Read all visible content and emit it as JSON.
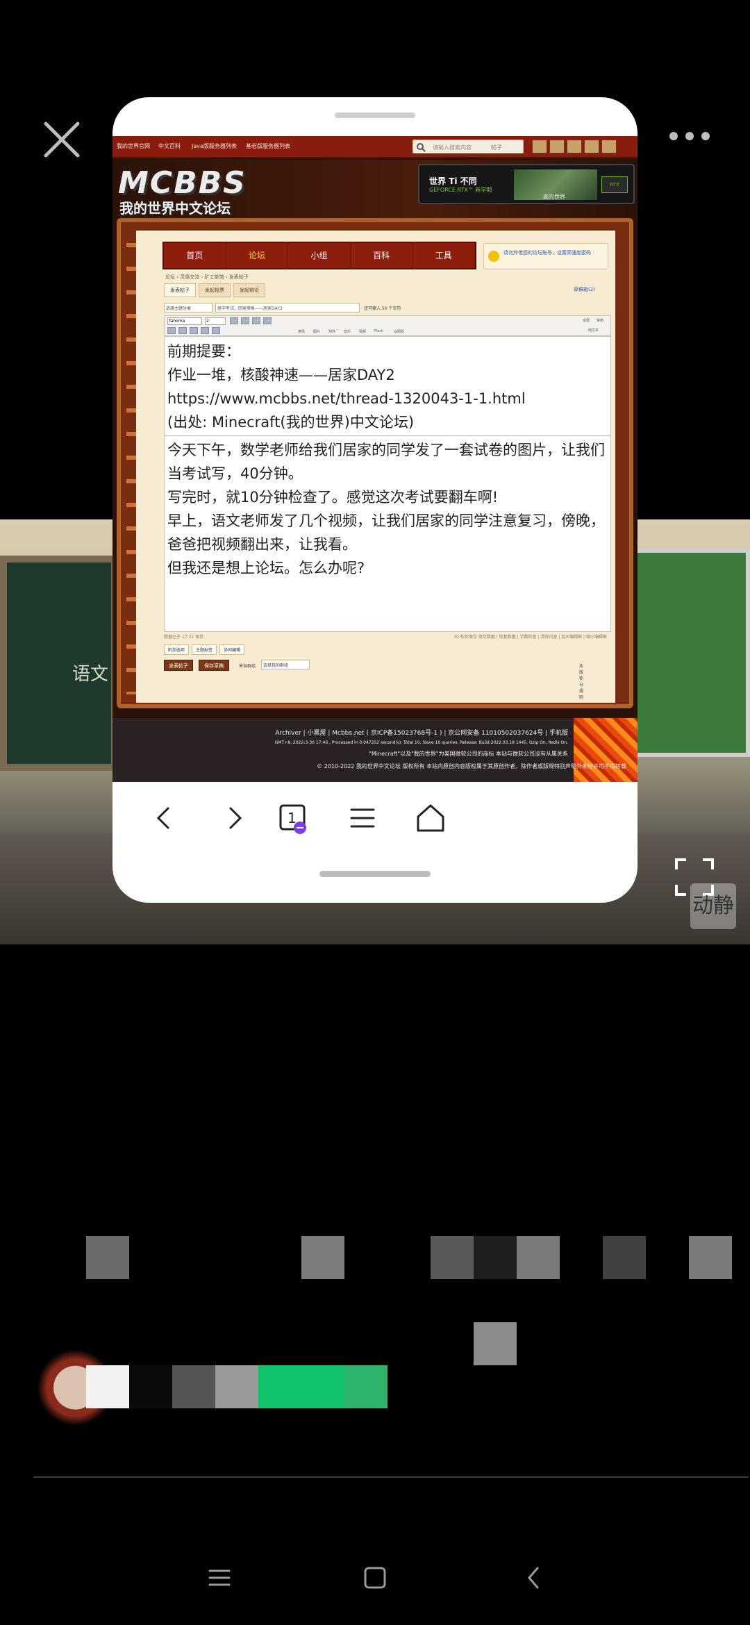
{
  "overlay": {
    "watermark_text": "动静"
  },
  "background": {
    "board_text": "语文"
  },
  "forum": {
    "topbar": {
      "links": [
        "我的世界官网",
        "中文百科",
        "Java版服务器列表",
        "基岩版服务器列表"
      ],
      "search_placeholder": "请输入搜索内容",
      "search_type": "帖子"
    },
    "logo_text": "MCBBS",
    "logo_sub": "我的世界中文论坛",
    "ad": {
      "line1": "世界 Ti 不同",
      "line2": "GEFORCE RTX™ 新学期",
      "caption": "高的世界",
      "chip": "RTX"
    },
    "menu": [
      "首页",
      "论坛",
      "小组",
      "百科",
      "工具"
    ],
    "menu_active_index": 1,
    "notice": "请勿外借您的论坛账号，设置高强度密码",
    "breadcrumb": "论坛 › 灵感交流 › 矿工茶馆 › 发表帖子",
    "tabs": [
      "发表帖子",
      "发起投票",
      "发起辩论"
    ],
    "edit_link": "草稿箱(2)",
    "subject": {
      "type_select": "选择主题分类",
      "title_value": "居中考试，回家摸鱼——居家DAY3",
      "hint": "还可输入 50 个字符"
    },
    "toolbar": {
      "font": "Tahoma",
      "size": "2",
      "labels": [
        "表情",
        "图片",
        "附件",
        "音乐",
        "视频",
        "Flash",
        "@朋友"
      ],
      "right_labels": [
        "全屏",
        "常用",
        "纯文本"
      ]
    },
    "editor": {
      "quote_lines": [
        "前期提要：",
        "作业一堆，核酸神速——居家DAY2",
        "https://www.mcbbs.net/thread-1320043-1-1.html",
        "(出处: Minecraft(我的世界)中文论坛)"
      ],
      "body_lines": [
        "今天下午，数学老师给我们居家的同学发了一套试卷的图片，让我们当考试写，40分钟。",
        "写完时，就10分钟检查了。感觉这次考试要翻车啊!",
        "早上，语文老师发了几个视频，让我们居家的同学注意复习，傍晚，爸爸把视频翻出来，让我看。",
        "但我还是想上论坛。怎么办呢?"
      ]
    },
    "status": {
      "left": "数据已于 17:31 保存",
      "right": "30 秒后保存 保存数据 | 恢复数据 | 字数检查 | 清除内容 | 加大编辑框 | 缩小编辑框"
    },
    "options": [
      "附加选项",
      "主题标签",
      "协同编辑"
    ],
    "actions": {
      "post": "发表帖子",
      "save_draft": "保存草稿",
      "origin_label": "来自群组",
      "origin_select": "选择我的群组",
      "rules": "本版积分规则"
    },
    "footer": {
      "line1": "Archiver | 小黑屋 | Mcbbs.net ( 京ICP备15023768号-1 ) | 京公网安备 11010502037624号 | 手机版",
      "line2": "GMT+8, 2022-3-30 17:46 , Processed in 0.047252 second(s), Total 10, Slave 10 queries, Release: Build.2022.03.18 1445, Gzip On, Redis On.",
      "line3": "\"Minecraft\"以及\"我的世界\"为美国微软公司的商标 本站与微软公司没有从属关系",
      "line4": "© 2010-2022 我的世界中文论坛 版权所有 本站内原创内容版权属于其原创作者，除作者或版规特别声明外未经许可不得转载"
    }
  },
  "browser": {
    "tab_count": "1"
  },
  "colors": {
    "forum_red": "#8d1e0e",
    "paper": "#f7ebd1",
    "menu_active": "#ffd24a",
    "ad_green": "#76b900"
  }
}
